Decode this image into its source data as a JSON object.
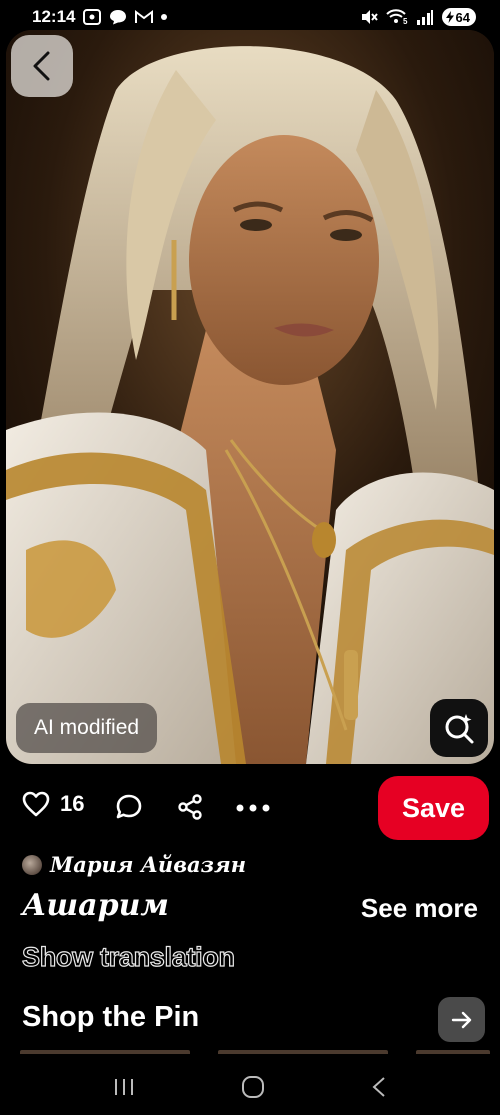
{
  "status_bar": {
    "time": "12:14",
    "battery": "64",
    "wifi_label": "5",
    "icons": [
      "screenshot-icon",
      "chat-icon",
      "gmail-icon",
      "dot-icon",
      "mute-icon",
      "wifi-icon",
      "signal-icon",
      "battery-charging-icon"
    ]
  },
  "pin": {
    "ai_badge": "AI modified",
    "image_description_icon": "portrait-image"
  },
  "actions": {
    "like_count": "16",
    "save_label": "Save"
  },
  "author": {
    "name": "Мария Айвазян"
  },
  "details": {
    "title": "Ашарим",
    "see_more": "See more",
    "show_translation": "Show translation"
  },
  "shop": {
    "title": "Shop the Pin"
  },
  "colors": {
    "save_red": "#e60023",
    "background": "#000000"
  }
}
